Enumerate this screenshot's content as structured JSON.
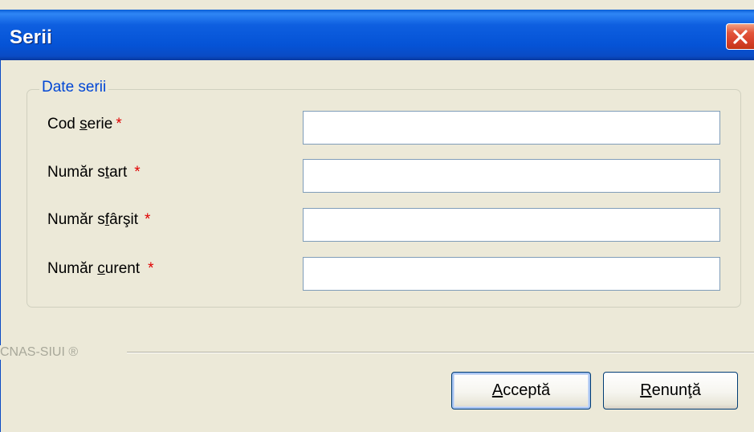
{
  "window": {
    "title": "Serii",
    "close_icon": "close-icon"
  },
  "group": {
    "legend": "Date serii",
    "fields": [
      {
        "pre": "Cod ",
        "mnemonic": "s",
        "post": "erie",
        "required": "*",
        "value": ""
      },
      {
        "pre": "Număr s",
        "mnemonic": "t",
        "post": "art",
        "required": "*",
        "value": ""
      },
      {
        "pre": "Număr s",
        "mnemonic": "f",
        "post": "ârşit",
        "required": "*",
        "value": ""
      },
      {
        "pre": "Număr ",
        "mnemonic": "c",
        "post": "urent",
        "required": "*",
        "value": ""
      }
    ]
  },
  "footer": {
    "brand": "CNAS-SIUI ®"
  },
  "buttons": {
    "ok": {
      "mnemonic": "A",
      "rest": "cceptă"
    },
    "cancel": {
      "mnemonic": "R",
      "rest": "enunţă"
    }
  },
  "colors": {
    "titlebar": "#0553d6",
    "dialog_bg": "#ece9d8",
    "legend": "#0046d5",
    "required": "#e00000",
    "close_button": "#d6402a"
  }
}
